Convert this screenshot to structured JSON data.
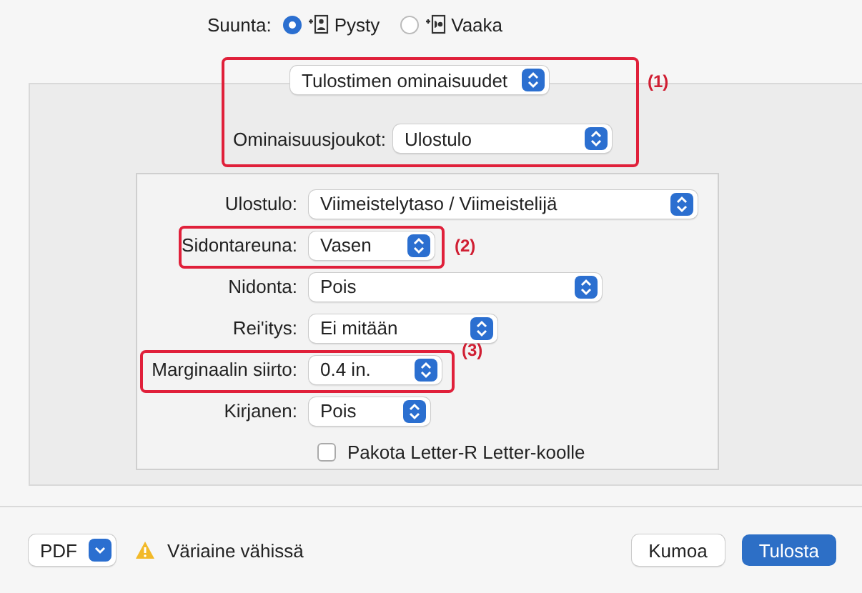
{
  "orientation": {
    "label": "Suunta:",
    "options": [
      {
        "label": "Pysty",
        "selected": true,
        "kind": "portrait"
      },
      {
        "label": "Vaaka",
        "selected": false,
        "kind": "landscape"
      }
    ]
  },
  "panel_menu": {
    "value": "Tulostimen ominaisuudet",
    "callout": "(1)"
  },
  "feature_sets": {
    "label": "Ominaisuusjoukot:",
    "value": "Ulostulo"
  },
  "settings": [
    {
      "kind": "popup",
      "label": "Ulostulo:",
      "value": "Viimeistelytaso / Viimeistelijä"
    },
    {
      "kind": "popup",
      "label": "Sidontareuna:",
      "value": "Vasen",
      "callout": "(2)"
    },
    {
      "kind": "popup",
      "label": "Nidonta:",
      "value": "Pois"
    },
    {
      "kind": "popup",
      "label": "Rei'itys:",
      "value": "Ei mitään"
    },
    {
      "kind": "popup",
      "label": "Marginaalin siirto:",
      "value": "0.4 in.",
      "callout": "(3)"
    },
    {
      "kind": "popup",
      "label": "Kirjanen:",
      "value": "Pois"
    },
    {
      "kind": "checkbox",
      "label": "Pakota Letter-R Letter-koolle",
      "checked": false
    }
  ],
  "footer": {
    "pdf": "PDF",
    "warning": "Väriaine vähissä",
    "buttons": [
      {
        "label": "Kumoa",
        "primary": false
      },
      {
        "label": "Tulosta",
        "primary": true
      }
    ]
  }
}
